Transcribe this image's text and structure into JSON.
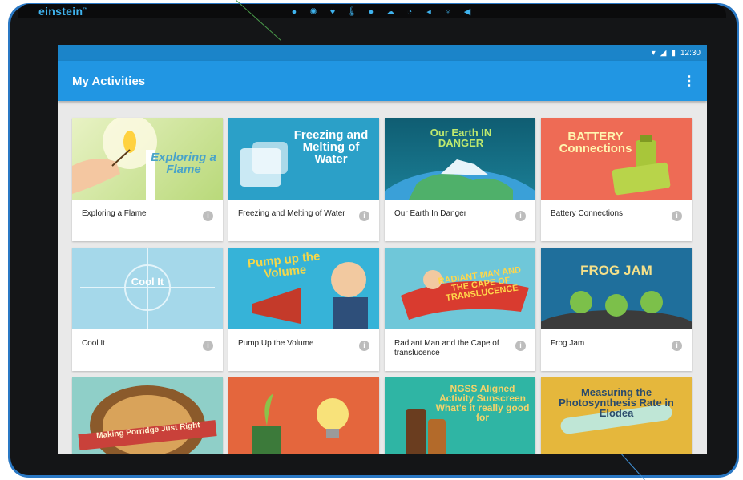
{
  "device": {
    "brand": "einstein",
    "brand_mark": "™",
    "sensor_icons": [
      "pin-icon",
      "sun-icon",
      "heart-icon",
      "thermometer-icon",
      "drop-icon",
      "cloud-icon",
      "gauge-icon",
      "arrow-icon",
      "key-icon",
      "speaker-icon"
    ]
  },
  "status_bar": {
    "wifi": "▾",
    "signal": "◢",
    "battery": "▮",
    "time": "12:30"
  },
  "app_bar": {
    "title": "My Activities",
    "menu": "⋮"
  },
  "activities": [
    {
      "label": "Exploring a Flame",
      "thumb_text": "Exploring a Flame",
      "info": "i"
    },
    {
      "label": "Freezing and Melting of Water",
      "thumb_text": "Freezing and Melting of Water",
      "info": "i"
    },
    {
      "label": "Our Earth In Danger",
      "thumb_text": "Our Earth IN DANGER",
      "info": "i"
    },
    {
      "label": "Battery Connections",
      "thumb_text": "BATTERY Connections",
      "info": "i"
    },
    {
      "label": "Cool It",
      "thumb_text": "Cool It",
      "info": "i"
    },
    {
      "label": "Pump Up the Volume",
      "thumb_text": "Pump up the Volume",
      "info": "i"
    },
    {
      "label": "Radiant Man and the Cape of translucence",
      "thumb_text": "RADIANT-MAN AND THE CAPE OF TRANSLUCENCE",
      "info": "i"
    },
    {
      "label": "Frog Jam",
      "thumb_text": "FROG JAM",
      "info": "i"
    },
    {
      "label": "",
      "thumb_text": "Making Porridge Just Right",
      "info": ""
    },
    {
      "label": "",
      "thumb_text": "",
      "info": ""
    },
    {
      "label": "",
      "thumb_text": "NGSS Aligned Activity Sunscreen What's it really good for",
      "info": ""
    },
    {
      "label": "",
      "thumb_text": "Measuring the Photosynthesis Rate in Elodea",
      "info": ""
    }
  ]
}
